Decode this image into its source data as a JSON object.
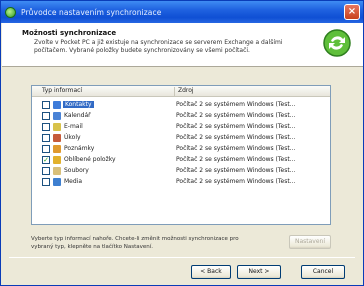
{
  "window": {
    "title": "Průvodce nastavením synchronizace",
    "close_glyph": "×"
  },
  "header": {
    "title": "Možnosti synchronizace",
    "description": "Zvolte v Pocket PC a již existuje na synchronizace se serverem Exchange a dalšími počítačem. Vybrané položky budete synchronizovány se všemi počítači."
  },
  "list": {
    "col_type": "Typ informací",
    "col_status": "Zdroj",
    "items": [
      {
        "checked": false,
        "label": "Kontakty",
        "selected": true,
        "status": "Počítač 2 se systémem Windows (Test...",
        "icon_color": "#3d7bd9"
      },
      {
        "checked": false,
        "label": "Kalendář",
        "selected": false,
        "status": "Počítač 2 se systémem Windows (Test...",
        "icon_color": "#4a83d6"
      },
      {
        "checked": false,
        "label": "E-mail",
        "selected": false,
        "status": "Počítač 2 se systémem Windows (Test...",
        "icon_color": "#d8c24a"
      },
      {
        "checked": false,
        "label": "Úkoly",
        "selected": false,
        "status": "Počítač 2 se systémem Windows (Test...",
        "icon_color": "#c65b3a"
      },
      {
        "checked": false,
        "label": "Poznámky",
        "selected": false,
        "status": "Počítač 2 se systémem Windows (Test...",
        "icon_color": "#e09a2e"
      },
      {
        "checked": true,
        "label": "Oblíbené položky",
        "selected": false,
        "status": "Počítač 2 se systémem Windows (Test...",
        "icon_color": "#e2b12c"
      },
      {
        "checked": false,
        "label": "Soubory",
        "selected": false,
        "status": "Počítač 2 se systémem Windows (Test...",
        "icon_color": "#d9c07a"
      },
      {
        "checked": false,
        "label": "Media",
        "selected": false,
        "status": "Počítač 2 se systémem Windows (Test...",
        "icon_color": "#3e7fd0"
      }
    ]
  },
  "footer_text": "Vyberte typ informací nahoře. Chcete-li změnit možnosti synchronizace pro vybraný typ, klepněte na tlačítko Nastavení.",
  "buttons": {
    "settings": "Nastavení",
    "back": "< Back",
    "next": "Next >",
    "cancel": "Cancel"
  }
}
